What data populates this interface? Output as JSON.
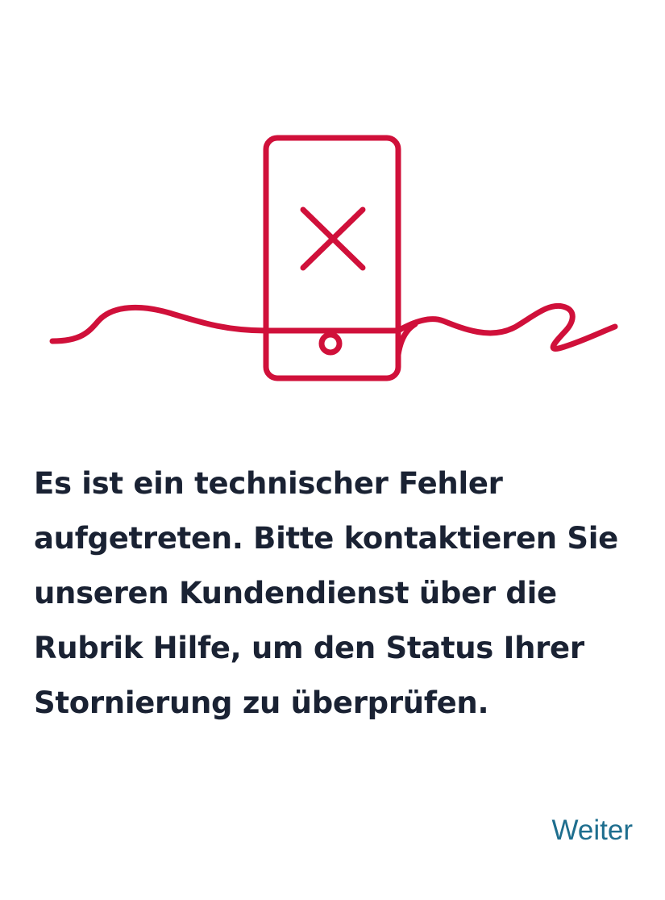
{
  "illustration": {
    "icon": "phone-error-icon",
    "stroke_color": "#d0103a"
  },
  "error": {
    "message": "Es ist ein technischer Fehler aufgetreten. Bitte kontaktieren Sie unseren Kundendienst über die Rubrik Hilfe, um den Status Ihrer Stornierung zu überprüfen."
  },
  "actions": {
    "continue_label": "Weiter",
    "continue_color": "#1e6e8e"
  },
  "colors": {
    "text": "#1a2233",
    "background": "#ffffff"
  }
}
